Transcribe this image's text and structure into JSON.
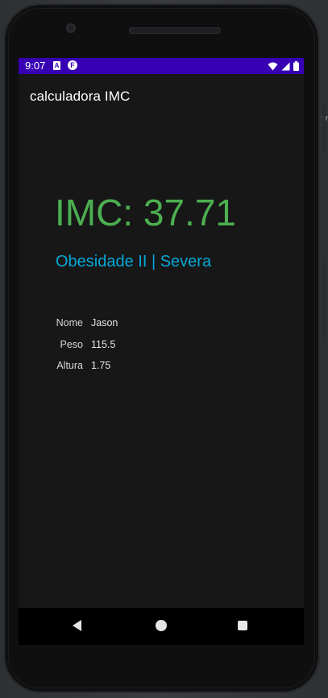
{
  "status_bar": {
    "time": "9:07",
    "notification_icons": [
      "a-badge-icon",
      "f-circle-icon"
    ],
    "system_icons": [
      "wifi-icon",
      "signal-icon",
      "battery-icon"
    ],
    "background_color": "#3700b3"
  },
  "app_bar": {
    "title": "calculadora IMC"
  },
  "result": {
    "imc_text": "IMC: 37.71",
    "imc_color": "#4caf50",
    "category": "Obesidade II | Severa",
    "category_color": "#03a9d8"
  },
  "details": [
    {
      "label": "Nome",
      "value": "Jason"
    },
    {
      "label": "Peso",
      "value": "115.5"
    },
    {
      "label": "Altura",
      "value": "1.75"
    }
  ],
  "nav_bar": {
    "buttons": [
      "back-icon",
      "home-icon",
      "recents-icon"
    ]
  }
}
